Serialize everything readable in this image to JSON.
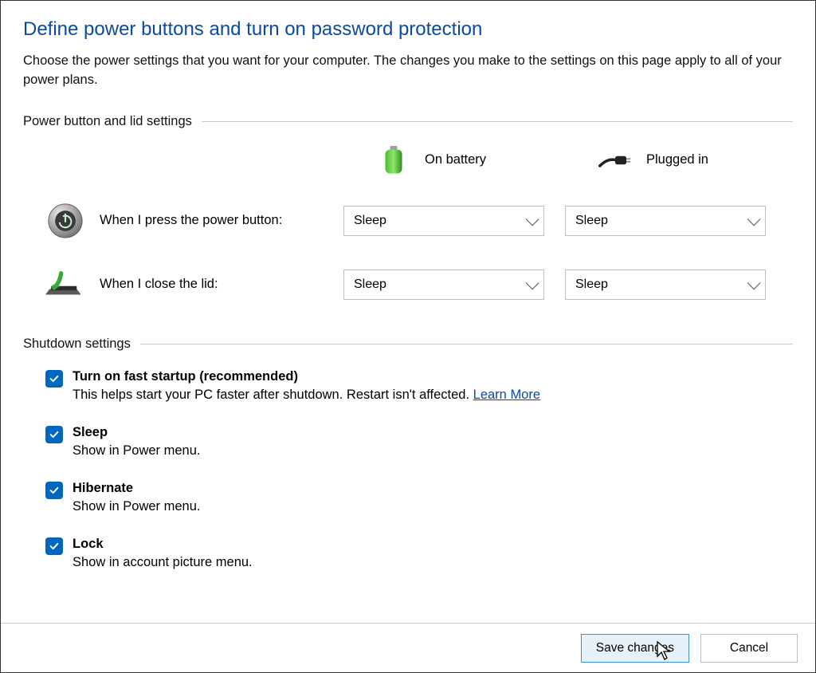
{
  "header": {
    "title": "Define power buttons and turn on password protection",
    "description": "Choose the power settings that you want for your computer. The changes you make to the settings on this page apply to all of your power plans."
  },
  "sections": {
    "power_lid": {
      "title": "Power button and lid settings",
      "columns": {
        "battery": "On battery",
        "plugged": "Plugged in"
      },
      "rows": {
        "power_button": {
          "label": "When I press the power button:",
          "battery_value": "Sleep",
          "plugged_value": "Sleep"
        },
        "close_lid": {
          "label": "When I close the lid:",
          "battery_value": "Sleep",
          "plugged_value": "Sleep"
        }
      }
    },
    "shutdown": {
      "title": "Shutdown settings",
      "options": {
        "fast_startup": {
          "checked": true,
          "label": "Turn on fast startup (recommended)",
          "sub": "This helps start your PC faster after shutdown. Restart isn't affected. ",
          "link": "Learn More"
        },
        "sleep": {
          "checked": true,
          "label": "Sleep",
          "sub": "Show in Power menu."
        },
        "hibernate": {
          "checked": true,
          "label": "Hibernate",
          "sub": "Show in Power menu."
        },
        "lock": {
          "checked": true,
          "label": "Lock",
          "sub": "Show in account picture menu."
        }
      }
    }
  },
  "footer": {
    "save": "Save changes",
    "cancel": "Cancel"
  }
}
